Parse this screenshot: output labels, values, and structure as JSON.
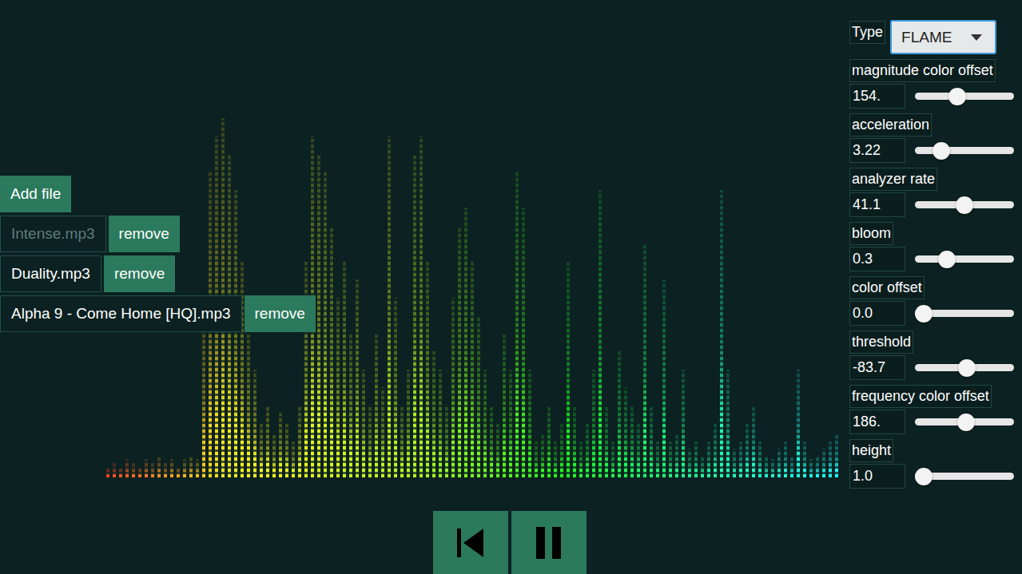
{
  "add_button": "Add file",
  "files": [
    {
      "name": "Intense.mp3",
      "disabled": true,
      "action": "remove"
    },
    {
      "name": "Duality.mp3",
      "disabled": false,
      "action": "remove"
    },
    {
      "name": "Alpha 9 - Come Home [HQ].mp3",
      "disabled": false,
      "action": "remove"
    }
  ],
  "type_select": {
    "label": "Type",
    "value": "FLAME",
    "focused": true
  },
  "sliders": [
    {
      "label": "magnitude color offset",
      "reading": "154.",
      "level": 0.41
    },
    {
      "label": "acceleration",
      "reading": "3.22",
      "level": 0.22
    },
    {
      "label": "analyzer rate",
      "reading": "41.1",
      "level": 0.5
    },
    {
      "label": "bloom",
      "reading": "0.3",
      "level": 0.28
    },
    {
      "label": "color offset",
      "reading": "0.0",
      "level": 0.0
    },
    {
      "label": "threshold",
      "reading": "-83.7",
      "level": 0.53
    },
    {
      "label": "frequency color offset",
      "reading": "186.",
      "level": 0.52
    },
    {
      "label": "height",
      "reading": "1.0",
      "level": 0.0
    }
  ],
  "transport": {
    "playing": true
  },
  "spectrum": {
    "magnitudes": [
      0.03,
      0.04,
      0.03,
      0.05,
      0.04,
      0.03,
      0.05,
      0.04,
      0.06,
      0.04,
      0.05,
      0.03,
      0.05,
      0.06,
      0.05,
      0.5,
      0.85,
      0.95,
      1.0,
      0.9,
      0.8,
      0.6,
      0.4,
      0.3,
      0.15,
      0.2,
      0.12,
      0.18,
      0.15,
      0.1,
      0.2,
      0.6,
      0.95,
      0.9,
      0.85,
      0.7,
      0.5,
      0.6,
      0.4,
      0.55,
      0.3,
      0.2,
      0.4,
      0.25,
      0.95,
      0.5,
      0.2,
      0.3,
      0.9,
      0.95,
      0.6,
      0.35,
      0.3,
      0.2,
      0.5,
      0.7,
      0.75,
      0.6,
      0.45,
      0.3,
      0.2,
      0.15,
      0.4,
      0.3,
      0.85,
      0.75,
      0.3,
      0.1,
      0.12,
      0.2,
      0.1,
      0.15,
      0.6,
      0.2,
      0.1,
      0.15,
      0.3,
      0.8,
      0.2,
      0.1,
      0.35,
      0.25,
      0.2,
      0.15,
      0.65,
      0.2,
      0.1,
      0.55,
      0.1,
      0.12,
      0.3,
      0.08,
      0.1,
      0.06,
      0.1,
      0.15,
      0.8,
      0.3,
      0.08,
      0.1,
      0.15,
      0.2,
      0.1,
      0.06,
      0.05,
      0.08,
      0.1,
      0.06,
      0.3,
      0.1,
      0.05,
      0.06,
      0.08,
      0.1,
      0.12
    ]
  }
}
